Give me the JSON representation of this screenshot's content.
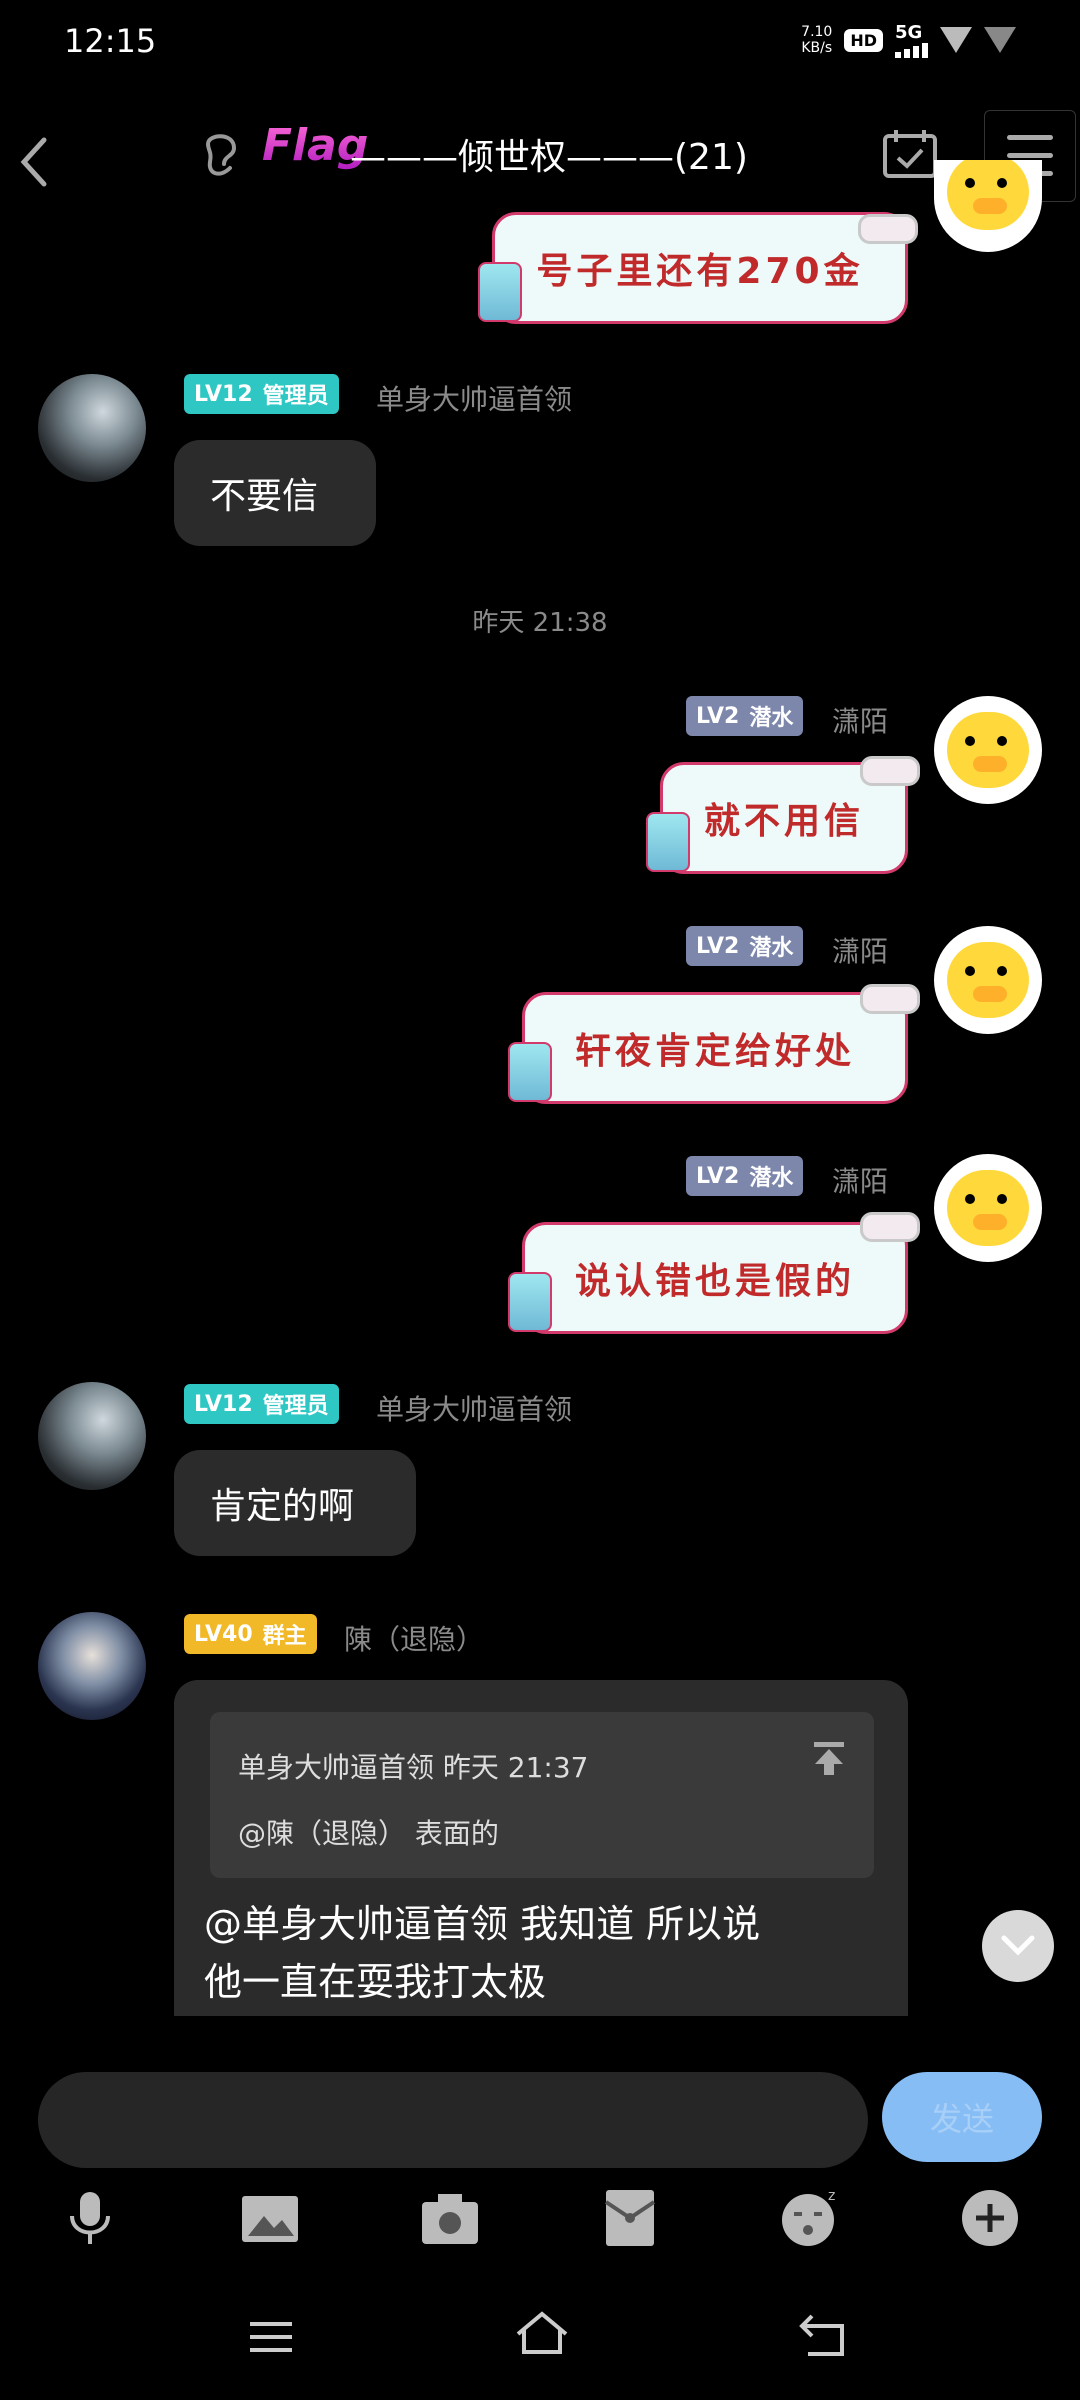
{
  "status": {
    "time": "12:15",
    "net_speed_value": "7.10",
    "net_speed_unit": "KB/s",
    "hd": "HD",
    "network": "5G"
  },
  "header": {
    "flag": "Flag",
    "group_name": "———倾世权———(21)"
  },
  "messages": [
    {
      "text": "号子里还有270金"
    },
    {
      "badge_level": "LV12",
      "badge_role": "管理员",
      "nickname": "单身大帅逼首领",
      "text": "不要信"
    },
    {
      "text": "就不用信",
      "badge_level": "LV2",
      "badge_role": "潜水",
      "nickname": "潇陌"
    },
    {
      "text": "轩夜肯定给好处",
      "badge_level": "LV2",
      "badge_role": "潜水",
      "nickname": "潇陌"
    },
    {
      "text": "说认错也是假的",
      "badge_level": "LV2",
      "badge_role": "潜水",
      "nickname": "潇陌"
    },
    {
      "badge_level": "LV12",
      "badge_role": "管理员",
      "nickname": "单身大帅逼首领",
      "text": "肯定的啊"
    },
    {
      "badge_level": "LV40",
      "badge_role": "群主",
      "nickname": "陳（退隐）",
      "quote_header": "单身大帅逼首领 昨天 21:37",
      "quote_body": "@陳（退隐） 表面的",
      "text_line1": "@单身大帅逼首领 我知道 所以说",
      "text_line2": "他一直在耍我打太极"
    }
  ],
  "time_separator": "昨天 21:38",
  "input": {
    "placeholder": "",
    "send_label": "发送"
  },
  "toolbar": [
    "mic-icon",
    "image-icon",
    "camera-icon",
    "redpacket-icon",
    "emoji-icon",
    "plus-icon"
  ],
  "colors": {
    "send_button": "#86bdf5",
    "admin_badge": "#2ec7c3",
    "dive_badge": "#7d87ab",
    "owner_badge": "#f1b827"
  }
}
